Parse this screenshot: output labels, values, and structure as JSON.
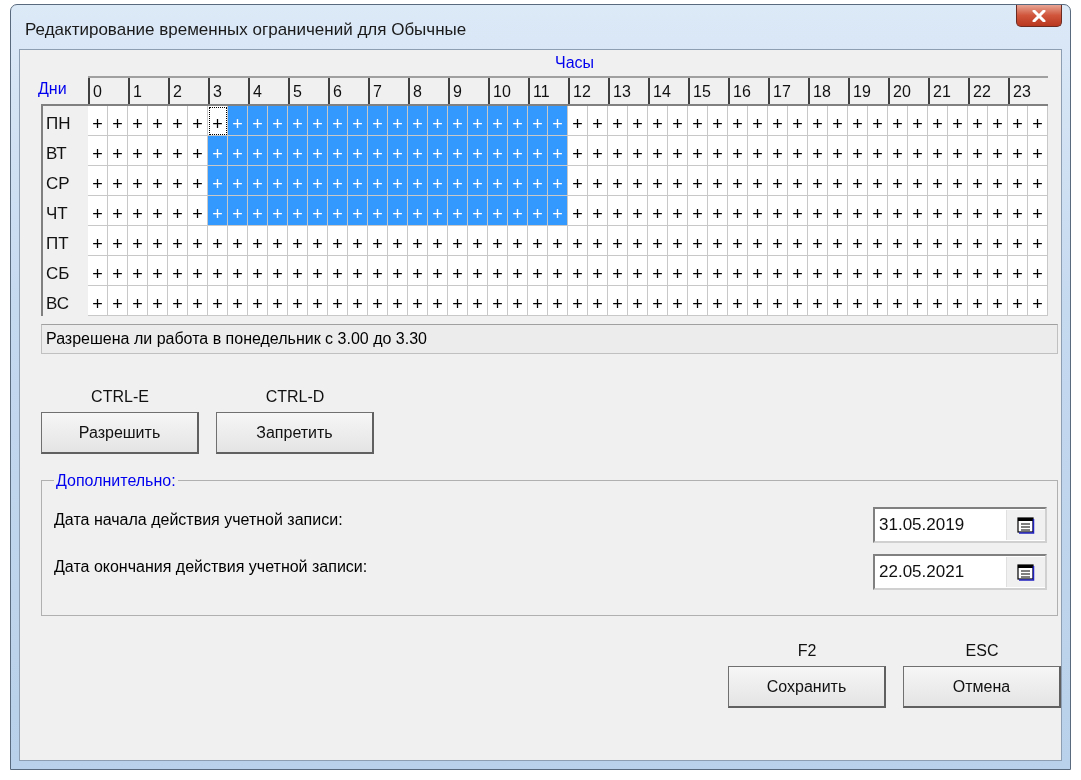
{
  "window": {
    "title": "Редактирование временных ограничений для Обычные"
  },
  "schedule": {
    "hours_label": "Часы",
    "days_label": "Дни",
    "hours": [
      "0",
      "1",
      "2",
      "3",
      "4",
      "5",
      "6",
      "7",
      "8",
      "9",
      "10",
      "11",
      "12",
      "13",
      "14",
      "15",
      "16",
      "17",
      "18",
      "19",
      "20",
      "21",
      "22",
      "23"
    ],
    "days": [
      {
        "label": "ПН",
        "cells": [
          {
            "mark": "+",
            "selected": false,
            "focused": false
          },
          {
            "mark": "+",
            "selected": false,
            "focused": false
          },
          {
            "mark": "+",
            "selected": false,
            "focused": false
          },
          {
            "mark": "+",
            "selected": false,
            "focused": false
          },
          {
            "mark": "+",
            "selected": false,
            "focused": false
          },
          {
            "mark": "+",
            "selected": false,
            "focused": false
          },
          {
            "mark": "+",
            "selected": false,
            "focused": true
          },
          {
            "mark": "+",
            "selected": true,
            "focused": false
          },
          {
            "mark": "+",
            "selected": true,
            "focused": false
          },
          {
            "mark": "+",
            "selected": true,
            "focused": false
          },
          {
            "mark": "+",
            "selected": true,
            "focused": false
          },
          {
            "mark": "+",
            "selected": true,
            "focused": false
          },
          {
            "mark": "+",
            "selected": true,
            "focused": false
          },
          {
            "mark": "+",
            "selected": true,
            "focused": false
          },
          {
            "mark": "+",
            "selected": true,
            "focused": false
          },
          {
            "mark": "+",
            "selected": true,
            "focused": false
          },
          {
            "mark": "+",
            "selected": true,
            "focused": false
          },
          {
            "mark": "+",
            "selected": true,
            "focused": false
          },
          {
            "mark": "+",
            "selected": true,
            "focused": false
          },
          {
            "mark": "+",
            "selected": true,
            "focused": false
          },
          {
            "mark": "+",
            "selected": true,
            "focused": false
          },
          {
            "mark": "+",
            "selected": true,
            "focused": false
          },
          {
            "mark": "+",
            "selected": true,
            "focused": false
          },
          {
            "mark": "+",
            "selected": true,
            "focused": false
          },
          {
            "mark": "+",
            "selected": false,
            "focused": false
          },
          {
            "mark": "+",
            "selected": false,
            "focused": false
          },
          {
            "mark": "+",
            "selected": false,
            "focused": false
          },
          {
            "mark": "+",
            "selected": false,
            "focused": false
          },
          {
            "mark": "+",
            "selected": false,
            "focused": false
          },
          {
            "mark": "+",
            "selected": false,
            "focused": false
          },
          {
            "mark": "+",
            "selected": false,
            "focused": false
          },
          {
            "mark": "+",
            "selected": false,
            "focused": false
          },
          {
            "mark": "+",
            "selected": false,
            "focused": false
          },
          {
            "mark": "+",
            "selected": false,
            "focused": false
          },
          {
            "mark": "+",
            "selected": false,
            "focused": false
          },
          {
            "mark": "+",
            "selected": false,
            "focused": false
          },
          {
            "mark": "+",
            "selected": false,
            "focused": false
          },
          {
            "mark": "+",
            "selected": false,
            "focused": false
          },
          {
            "mark": "+",
            "selected": false,
            "focused": false
          },
          {
            "mark": "+",
            "selected": false,
            "focused": false
          },
          {
            "mark": "+",
            "selected": false,
            "focused": false
          },
          {
            "mark": "+",
            "selected": false,
            "focused": false
          },
          {
            "mark": "+",
            "selected": false,
            "focused": false
          },
          {
            "mark": "+",
            "selected": false,
            "focused": false
          },
          {
            "mark": "+",
            "selected": false,
            "focused": false
          },
          {
            "mark": "+",
            "selected": false,
            "focused": false
          },
          {
            "mark": "+",
            "selected": false,
            "focused": false
          },
          {
            "mark": "+",
            "selected": false,
            "focused": false
          }
        ]
      },
      {
        "label": "ВТ",
        "cells": [
          {
            "mark": "+",
            "selected": false,
            "focused": false
          },
          {
            "mark": "+",
            "selected": false,
            "focused": false
          },
          {
            "mark": "+",
            "selected": false,
            "focused": false
          },
          {
            "mark": "+",
            "selected": false,
            "focused": false
          },
          {
            "mark": "+",
            "selected": false,
            "focused": false
          },
          {
            "mark": "+",
            "selected": false,
            "focused": false
          },
          {
            "mark": "+",
            "selected": true,
            "focused": false
          },
          {
            "mark": "+",
            "selected": true,
            "focused": false
          },
          {
            "mark": "+",
            "selected": true,
            "focused": false
          },
          {
            "mark": "+",
            "selected": true,
            "focused": false
          },
          {
            "mark": "+",
            "selected": true,
            "focused": false
          },
          {
            "mark": "+",
            "selected": true,
            "focused": false
          },
          {
            "mark": "+",
            "selected": true,
            "focused": false
          },
          {
            "mark": "+",
            "selected": true,
            "focused": false
          },
          {
            "mark": "+",
            "selected": true,
            "focused": false
          },
          {
            "mark": "+",
            "selected": true,
            "focused": false
          },
          {
            "mark": "+",
            "selected": true,
            "focused": false
          },
          {
            "mark": "+",
            "selected": true,
            "focused": false
          },
          {
            "mark": "+",
            "selected": true,
            "focused": false
          },
          {
            "mark": "+",
            "selected": true,
            "focused": false
          },
          {
            "mark": "+",
            "selected": true,
            "focused": false
          },
          {
            "mark": "+",
            "selected": true,
            "focused": false
          },
          {
            "mark": "+",
            "selected": true,
            "focused": false
          },
          {
            "mark": "+",
            "selected": true,
            "focused": false
          },
          {
            "mark": "+",
            "selected": false,
            "focused": false
          },
          {
            "mark": "+",
            "selected": false,
            "focused": false
          },
          {
            "mark": "+",
            "selected": false,
            "focused": false
          },
          {
            "mark": "+",
            "selected": false,
            "focused": false
          },
          {
            "mark": "+",
            "selected": false,
            "focused": false
          },
          {
            "mark": "+",
            "selected": false,
            "focused": false
          },
          {
            "mark": "+",
            "selected": false,
            "focused": false
          },
          {
            "mark": "+",
            "selected": false,
            "focused": false
          },
          {
            "mark": "+",
            "selected": false,
            "focused": false
          },
          {
            "mark": "+",
            "selected": false,
            "focused": false
          },
          {
            "mark": "+",
            "selected": false,
            "focused": false
          },
          {
            "mark": "+",
            "selected": false,
            "focused": false
          },
          {
            "mark": "+",
            "selected": false,
            "focused": false
          },
          {
            "mark": "+",
            "selected": false,
            "focused": false
          },
          {
            "mark": "+",
            "selected": false,
            "focused": false
          },
          {
            "mark": "+",
            "selected": false,
            "focused": false
          },
          {
            "mark": "+",
            "selected": false,
            "focused": false
          },
          {
            "mark": "+",
            "selected": false,
            "focused": false
          },
          {
            "mark": "+",
            "selected": false,
            "focused": false
          },
          {
            "mark": "+",
            "selected": false,
            "focused": false
          },
          {
            "mark": "+",
            "selected": false,
            "focused": false
          },
          {
            "mark": "+",
            "selected": false,
            "focused": false
          },
          {
            "mark": "+",
            "selected": false,
            "focused": false
          },
          {
            "mark": "+",
            "selected": false,
            "focused": false
          }
        ]
      },
      {
        "label": "СР",
        "cells": [
          {
            "mark": "+",
            "selected": false,
            "focused": false
          },
          {
            "mark": "+",
            "selected": false,
            "focused": false
          },
          {
            "mark": "+",
            "selected": false,
            "focused": false
          },
          {
            "mark": "+",
            "selected": false,
            "focused": false
          },
          {
            "mark": "+",
            "selected": false,
            "focused": false
          },
          {
            "mark": "+",
            "selected": false,
            "focused": false
          },
          {
            "mark": "+",
            "selected": true,
            "focused": false
          },
          {
            "mark": "+",
            "selected": true,
            "focused": false
          },
          {
            "mark": "+",
            "selected": true,
            "focused": false
          },
          {
            "mark": "+",
            "selected": true,
            "focused": false
          },
          {
            "mark": "+",
            "selected": true,
            "focused": false
          },
          {
            "mark": "+",
            "selected": true,
            "focused": false
          },
          {
            "mark": "+",
            "selected": true,
            "focused": false
          },
          {
            "mark": "+",
            "selected": true,
            "focused": false
          },
          {
            "mark": "+",
            "selected": true,
            "focused": false
          },
          {
            "mark": "+",
            "selected": true,
            "focused": false
          },
          {
            "mark": "+",
            "selected": true,
            "focused": false
          },
          {
            "mark": "+",
            "selected": true,
            "focused": false
          },
          {
            "mark": "+",
            "selected": true,
            "focused": false
          },
          {
            "mark": "+",
            "selected": true,
            "focused": false
          },
          {
            "mark": "+",
            "selected": true,
            "focused": false
          },
          {
            "mark": "+",
            "selected": true,
            "focused": false
          },
          {
            "mark": "+",
            "selected": true,
            "focused": false
          },
          {
            "mark": "+",
            "selected": true,
            "focused": false
          },
          {
            "mark": "+",
            "selected": false,
            "focused": false
          },
          {
            "mark": "+",
            "selected": false,
            "focused": false
          },
          {
            "mark": "+",
            "selected": false,
            "focused": false
          },
          {
            "mark": "+",
            "selected": false,
            "focused": false
          },
          {
            "mark": "+",
            "selected": false,
            "focused": false
          },
          {
            "mark": "+",
            "selected": false,
            "focused": false
          },
          {
            "mark": "+",
            "selected": false,
            "focused": false
          },
          {
            "mark": "+",
            "selected": false,
            "focused": false
          },
          {
            "mark": "+",
            "selected": false,
            "focused": false
          },
          {
            "mark": "+",
            "selected": false,
            "focused": false
          },
          {
            "mark": "+",
            "selected": false,
            "focused": false
          },
          {
            "mark": "+",
            "selected": false,
            "focused": false
          },
          {
            "mark": "+",
            "selected": false,
            "focused": false
          },
          {
            "mark": "+",
            "selected": false,
            "focused": false
          },
          {
            "mark": "+",
            "selected": false,
            "focused": false
          },
          {
            "mark": "+",
            "selected": false,
            "focused": false
          },
          {
            "mark": "+",
            "selected": false,
            "focused": false
          },
          {
            "mark": "+",
            "selected": false,
            "focused": false
          },
          {
            "mark": "+",
            "selected": false,
            "focused": false
          },
          {
            "mark": "+",
            "selected": false,
            "focused": false
          },
          {
            "mark": "+",
            "selected": false,
            "focused": false
          },
          {
            "mark": "+",
            "selected": false,
            "focused": false
          },
          {
            "mark": "+",
            "selected": false,
            "focused": false
          },
          {
            "mark": "+",
            "selected": false,
            "focused": false
          }
        ]
      },
      {
        "label": "ЧТ",
        "cells": [
          {
            "mark": "+",
            "selected": false,
            "focused": false
          },
          {
            "mark": "+",
            "selected": false,
            "focused": false
          },
          {
            "mark": "+",
            "selected": false,
            "focused": false
          },
          {
            "mark": "+",
            "selected": false,
            "focused": false
          },
          {
            "mark": "+",
            "selected": false,
            "focused": false
          },
          {
            "mark": "+",
            "selected": false,
            "focused": false
          },
          {
            "mark": "+",
            "selected": true,
            "focused": false
          },
          {
            "mark": "+",
            "selected": true,
            "focused": false
          },
          {
            "mark": "+",
            "selected": true,
            "focused": false
          },
          {
            "mark": "+",
            "selected": true,
            "focused": false
          },
          {
            "mark": "+",
            "selected": true,
            "focused": false
          },
          {
            "mark": "+",
            "selected": true,
            "focused": false
          },
          {
            "mark": "+",
            "selected": true,
            "focused": false
          },
          {
            "mark": "+",
            "selected": true,
            "focused": false
          },
          {
            "mark": "+",
            "selected": true,
            "focused": false
          },
          {
            "mark": "+",
            "selected": true,
            "focused": false
          },
          {
            "mark": "+",
            "selected": true,
            "focused": false
          },
          {
            "mark": "+",
            "selected": true,
            "focused": false
          },
          {
            "mark": "+",
            "selected": true,
            "focused": false
          },
          {
            "mark": "+",
            "selected": true,
            "focused": false
          },
          {
            "mark": "+",
            "selected": true,
            "focused": false
          },
          {
            "mark": "+",
            "selected": true,
            "focused": false
          },
          {
            "mark": "+",
            "selected": true,
            "focused": false
          },
          {
            "mark": "+",
            "selected": true,
            "focused": false
          },
          {
            "mark": "+",
            "selected": false,
            "focused": false
          },
          {
            "mark": "+",
            "selected": false,
            "focused": false
          },
          {
            "mark": "+",
            "selected": false,
            "focused": false
          },
          {
            "mark": "+",
            "selected": false,
            "focused": false
          },
          {
            "mark": "+",
            "selected": false,
            "focused": false
          },
          {
            "mark": "+",
            "selected": false,
            "focused": false
          },
          {
            "mark": "+",
            "selected": false,
            "focused": false
          },
          {
            "mark": "+",
            "selected": false,
            "focused": false
          },
          {
            "mark": "+",
            "selected": false,
            "focused": false
          },
          {
            "mark": "+",
            "selected": false,
            "focused": false
          },
          {
            "mark": "+",
            "selected": false,
            "focused": false
          },
          {
            "mark": "+",
            "selected": false,
            "focused": false
          },
          {
            "mark": "+",
            "selected": false,
            "focused": false
          },
          {
            "mark": "+",
            "selected": false,
            "focused": false
          },
          {
            "mark": "+",
            "selected": false,
            "focused": false
          },
          {
            "mark": "+",
            "selected": false,
            "focused": false
          },
          {
            "mark": "+",
            "selected": false,
            "focused": false
          },
          {
            "mark": "+",
            "selected": false,
            "focused": false
          },
          {
            "mark": "+",
            "selected": false,
            "focused": false
          },
          {
            "mark": "+",
            "selected": false,
            "focused": false
          },
          {
            "mark": "+",
            "selected": false,
            "focused": false
          },
          {
            "mark": "+",
            "selected": false,
            "focused": false
          },
          {
            "mark": "+",
            "selected": false,
            "focused": false
          },
          {
            "mark": "+",
            "selected": false,
            "focused": false
          }
        ]
      },
      {
        "label": "ПТ",
        "cells": [
          {
            "mark": "+",
            "selected": false,
            "focused": false
          },
          {
            "mark": "+",
            "selected": false,
            "focused": false
          },
          {
            "mark": "+",
            "selected": false,
            "focused": false
          },
          {
            "mark": "+",
            "selected": false,
            "focused": false
          },
          {
            "mark": "+",
            "selected": false,
            "focused": false
          },
          {
            "mark": "+",
            "selected": false,
            "focused": false
          },
          {
            "mark": "+",
            "selected": false,
            "focused": false
          },
          {
            "mark": "+",
            "selected": false,
            "focused": false
          },
          {
            "mark": "+",
            "selected": false,
            "focused": false
          },
          {
            "mark": "+",
            "selected": false,
            "focused": false
          },
          {
            "mark": "+",
            "selected": false,
            "focused": false
          },
          {
            "mark": "+",
            "selected": false,
            "focused": false
          },
          {
            "mark": "+",
            "selected": false,
            "focused": false
          },
          {
            "mark": "+",
            "selected": false,
            "focused": false
          },
          {
            "mark": "+",
            "selected": false,
            "focused": false
          },
          {
            "mark": "+",
            "selected": false,
            "focused": false
          },
          {
            "mark": "+",
            "selected": false,
            "focused": false
          },
          {
            "mark": "+",
            "selected": false,
            "focused": false
          },
          {
            "mark": "+",
            "selected": false,
            "focused": false
          },
          {
            "mark": "+",
            "selected": false,
            "focused": false
          },
          {
            "mark": "+",
            "selected": false,
            "focused": false
          },
          {
            "mark": "+",
            "selected": false,
            "focused": false
          },
          {
            "mark": "+",
            "selected": false,
            "focused": false
          },
          {
            "mark": "+",
            "selected": false,
            "focused": false
          },
          {
            "mark": "+",
            "selected": false,
            "focused": false
          },
          {
            "mark": "+",
            "selected": false,
            "focused": false
          },
          {
            "mark": "+",
            "selected": false,
            "focused": false
          },
          {
            "mark": "+",
            "selected": false,
            "focused": false
          },
          {
            "mark": "+",
            "selected": false,
            "focused": false
          },
          {
            "mark": "+",
            "selected": false,
            "focused": false
          },
          {
            "mark": "+",
            "selected": false,
            "focused": false
          },
          {
            "mark": "+",
            "selected": false,
            "focused": false
          },
          {
            "mark": "+",
            "selected": false,
            "focused": false
          },
          {
            "mark": "+",
            "selected": false,
            "focused": false
          },
          {
            "mark": "+",
            "selected": false,
            "focused": false
          },
          {
            "mark": "+",
            "selected": false,
            "focused": false
          },
          {
            "mark": "+",
            "selected": false,
            "focused": false
          },
          {
            "mark": "+",
            "selected": false,
            "focused": false
          },
          {
            "mark": "+",
            "selected": false,
            "focused": false
          },
          {
            "mark": "+",
            "selected": false,
            "focused": false
          },
          {
            "mark": "+",
            "selected": false,
            "focused": false
          },
          {
            "mark": "+",
            "selected": false,
            "focused": false
          },
          {
            "mark": "+",
            "selected": false,
            "focused": false
          },
          {
            "mark": "+",
            "selected": false,
            "focused": false
          },
          {
            "mark": "+",
            "selected": false,
            "focused": false
          },
          {
            "mark": "+",
            "selected": false,
            "focused": false
          },
          {
            "mark": "+",
            "selected": false,
            "focused": false
          },
          {
            "mark": "+",
            "selected": false,
            "focused": false
          }
        ]
      },
      {
        "label": "СБ",
        "cells": [
          {
            "mark": "+",
            "selected": false,
            "focused": false
          },
          {
            "mark": "+",
            "selected": false,
            "focused": false
          },
          {
            "mark": "+",
            "selected": false,
            "focused": false
          },
          {
            "mark": "+",
            "selected": false,
            "focused": false
          },
          {
            "mark": "+",
            "selected": false,
            "focused": false
          },
          {
            "mark": "+",
            "selected": false,
            "focused": false
          },
          {
            "mark": "+",
            "selected": false,
            "focused": false
          },
          {
            "mark": "+",
            "selected": false,
            "focused": false
          },
          {
            "mark": "+",
            "selected": false,
            "focused": false
          },
          {
            "mark": "+",
            "selected": false,
            "focused": false
          },
          {
            "mark": "+",
            "selected": false,
            "focused": false
          },
          {
            "mark": "+",
            "selected": false,
            "focused": false
          },
          {
            "mark": "+",
            "selected": false,
            "focused": false
          },
          {
            "mark": "+",
            "selected": false,
            "focused": false
          },
          {
            "mark": "+",
            "selected": false,
            "focused": false
          },
          {
            "mark": "+",
            "selected": false,
            "focused": false
          },
          {
            "mark": "+",
            "selected": false,
            "focused": false
          },
          {
            "mark": "+",
            "selected": false,
            "focused": false
          },
          {
            "mark": "+",
            "selected": false,
            "focused": false
          },
          {
            "mark": "+",
            "selected": false,
            "focused": false
          },
          {
            "mark": "+",
            "selected": false,
            "focused": false
          },
          {
            "mark": "+",
            "selected": false,
            "focused": false
          },
          {
            "mark": "+",
            "selected": false,
            "focused": false
          },
          {
            "mark": "+",
            "selected": false,
            "focused": false
          },
          {
            "mark": "+",
            "selected": false,
            "focused": false
          },
          {
            "mark": "+",
            "selected": false,
            "focused": false
          },
          {
            "mark": "+",
            "selected": false,
            "focused": false
          },
          {
            "mark": "+",
            "selected": false,
            "focused": false
          },
          {
            "mark": "+",
            "selected": false,
            "focused": false
          },
          {
            "mark": "+",
            "selected": false,
            "focused": false
          },
          {
            "mark": "+",
            "selected": false,
            "focused": false
          },
          {
            "mark": "+",
            "selected": false,
            "focused": false
          },
          {
            "mark": "+",
            "selected": false,
            "focused": false
          },
          {
            "mark": "+",
            "selected": false,
            "focused": false
          },
          {
            "mark": "+",
            "selected": false,
            "focused": false
          },
          {
            "mark": "+",
            "selected": false,
            "focused": false
          },
          {
            "mark": "+",
            "selected": false,
            "focused": false
          },
          {
            "mark": "+",
            "selected": false,
            "focused": false
          },
          {
            "mark": "+",
            "selected": false,
            "focused": false
          },
          {
            "mark": "+",
            "selected": false,
            "focused": false
          },
          {
            "mark": "+",
            "selected": false,
            "focused": false
          },
          {
            "mark": "+",
            "selected": false,
            "focused": false
          },
          {
            "mark": "+",
            "selected": false,
            "focused": false
          },
          {
            "mark": "+",
            "selected": false,
            "focused": false
          },
          {
            "mark": "+",
            "selected": false,
            "focused": false
          },
          {
            "mark": "+",
            "selected": false,
            "focused": false
          },
          {
            "mark": "+",
            "selected": false,
            "focused": false
          },
          {
            "mark": "+",
            "selected": false,
            "focused": false
          }
        ]
      },
      {
        "label": "ВС",
        "cells": [
          {
            "mark": "+",
            "selected": false,
            "focused": false
          },
          {
            "mark": "+",
            "selected": false,
            "focused": false
          },
          {
            "mark": "+",
            "selected": false,
            "focused": false
          },
          {
            "mark": "+",
            "selected": false,
            "focused": false
          },
          {
            "mark": "+",
            "selected": false,
            "focused": false
          },
          {
            "mark": "+",
            "selected": false,
            "focused": false
          },
          {
            "mark": "+",
            "selected": false,
            "focused": false
          },
          {
            "mark": "+",
            "selected": false,
            "focused": false
          },
          {
            "mark": "+",
            "selected": false,
            "focused": false
          },
          {
            "mark": "+",
            "selected": false,
            "focused": false
          },
          {
            "mark": "+",
            "selected": false,
            "focused": false
          },
          {
            "mark": "+",
            "selected": false,
            "focused": false
          },
          {
            "mark": "+",
            "selected": false,
            "focused": false
          },
          {
            "mark": "+",
            "selected": false,
            "focused": false
          },
          {
            "mark": "+",
            "selected": false,
            "focused": false
          },
          {
            "mark": "+",
            "selected": false,
            "focused": false
          },
          {
            "mark": "+",
            "selected": false,
            "focused": false
          },
          {
            "mark": "+",
            "selected": false,
            "focused": false
          },
          {
            "mark": "+",
            "selected": false,
            "focused": false
          },
          {
            "mark": "+",
            "selected": false,
            "focused": false
          },
          {
            "mark": "+",
            "selected": false,
            "focused": false
          },
          {
            "mark": "+",
            "selected": false,
            "focused": false
          },
          {
            "mark": "+",
            "selected": false,
            "focused": false
          },
          {
            "mark": "+",
            "selected": false,
            "focused": false
          },
          {
            "mark": "+",
            "selected": false,
            "focused": false
          },
          {
            "mark": "+",
            "selected": false,
            "focused": false
          },
          {
            "mark": "+",
            "selected": false,
            "focused": false
          },
          {
            "mark": "+",
            "selected": false,
            "focused": false
          },
          {
            "mark": "+",
            "selected": false,
            "focused": false
          },
          {
            "mark": "+",
            "selected": false,
            "focused": false
          },
          {
            "mark": "+",
            "selected": false,
            "focused": false
          },
          {
            "mark": "+",
            "selected": false,
            "focused": false
          },
          {
            "mark": "+",
            "selected": false,
            "focused": false
          },
          {
            "mark": "+",
            "selected": false,
            "focused": false
          },
          {
            "mark": "+",
            "selected": false,
            "focused": false
          },
          {
            "mark": "+",
            "selected": false,
            "focused": false
          },
          {
            "mark": "+",
            "selected": false,
            "focused": false
          },
          {
            "mark": "+",
            "selected": false,
            "focused": false
          },
          {
            "mark": "+",
            "selected": false,
            "focused": false
          },
          {
            "mark": "+",
            "selected": false,
            "focused": false
          },
          {
            "mark": "+",
            "selected": false,
            "focused": false
          },
          {
            "mark": "+",
            "selected": false,
            "focused": false
          },
          {
            "mark": "+",
            "selected": false,
            "focused": false
          },
          {
            "mark": "+",
            "selected": false,
            "focused": false
          },
          {
            "mark": "+",
            "selected": false,
            "focused": false
          },
          {
            "mark": "+",
            "selected": false,
            "focused": false
          },
          {
            "mark": "+",
            "selected": false,
            "focused": false
          },
          {
            "mark": "+",
            "selected": false,
            "focused": false
          }
        ]
      }
    ]
  },
  "status_text": "Разрешена ли работа в понедельник с 3.00 до 3.30",
  "actions": [
    {
      "shortcut": "CTRL-E",
      "label": "Разрешить"
    },
    {
      "shortcut": "CTRL-D",
      "label": "Запретить"
    }
  ],
  "additional": {
    "title": "Дополнительно:",
    "fields": [
      {
        "label": "Дата начала действия учетной записи:",
        "value": "31.05.2019"
      },
      {
        "label": "Дата окончания действия учетной записи:",
        "value": "22.05.2021"
      }
    ]
  },
  "dialog_buttons": [
    {
      "shortcut": "F2",
      "label": "Сохранить"
    },
    {
      "shortcut": "ESC",
      "label": "Отмена"
    }
  ]
}
